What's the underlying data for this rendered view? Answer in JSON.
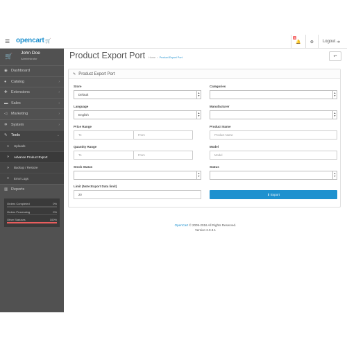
{
  "header": {
    "logo": "opencart",
    "notification_count": "3",
    "logout_label": "Logout"
  },
  "sidebar": {
    "user_name": "John Doe",
    "user_role": "Administrator",
    "items": [
      {
        "label": "Dashboard",
        "icon": "dashboard-icon"
      },
      {
        "label": "Catalog",
        "icon": "tag-icon"
      },
      {
        "label": "Extensions",
        "icon": "puzzle-icon"
      },
      {
        "label": "Sales",
        "icon": "cart-icon"
      },
      {
        "label": "Marketing",
        "icon": "share-icon"
      },
      {
        "label": "System",
        "icon": "cog-icon"
      },
      {
        "label": "Tools",
        "icon": "wrench-icon"
      }
    ],
    "tools_sub": [
      {
        "label": "Uploads"
      },
      {
        "label": "Advance Product Export"
      },
      {
        "label": "Backup / Restore"
      },
      {
        "label": "Error Logs"
      }
    ],
    "reports": {
      "label": "Reports",
      "icon": "bar-chart-icon"
    },
    "stats": [
      {
        "label": "Orders Completed",
        "value": "0%",
        "fraction": 0.0,
        "color": "#e85d5d"
      },
      {
        "label": "Orders Processing",
        "value": "0%",
        "fraction": 0.0,
        "color": "#e8a33d"
      },
      {
        "label": "Other Statuses",
        "value": "100%",
        "fraction": 1.0,
        "color": "#e85d5d"
      }
    ]
  },
  "main": {
    "title": "Product Export Port",
    "breadcrumb": {
      "home": "Home",
      "current": "Product Export Port"
    },
    "panel_title": "Product Export Port",
    "store_label": "Store",
    "store_value": "Default",
    "categories_label": "Categories",
    "language_label": "Language",
    "language_value": "English",
    "manufacturer_label": "Manufacturer",
    "price_range_label": "Price Range",
    "price_to_placeholder": "To",
    "price_from_placeholder": "From",
    "product_name_label": "Product Name",
    "product_name_placeholder": "Product Name",
    "quantity_range_label": "Quantity Range",
    "quantity_to_placeholder": "To",
    "quantity_from_placeholder": "From",
    "model_label": "Model",
    "model_placeholder": "Model",
    "stock_status_label": "Stock Status",
    "status_label": "Status",
    "limit_label": "Limit (Note:Export Data limit)",
    "limit_value": "20",
    "export_label": "Export"
  },
  "footer": {
    "brand": "OpenCart",
    "copyright": "© 2009-2016 All Rights Reserved.",
    "version": "Version 2.0.3.1"
  }
}
